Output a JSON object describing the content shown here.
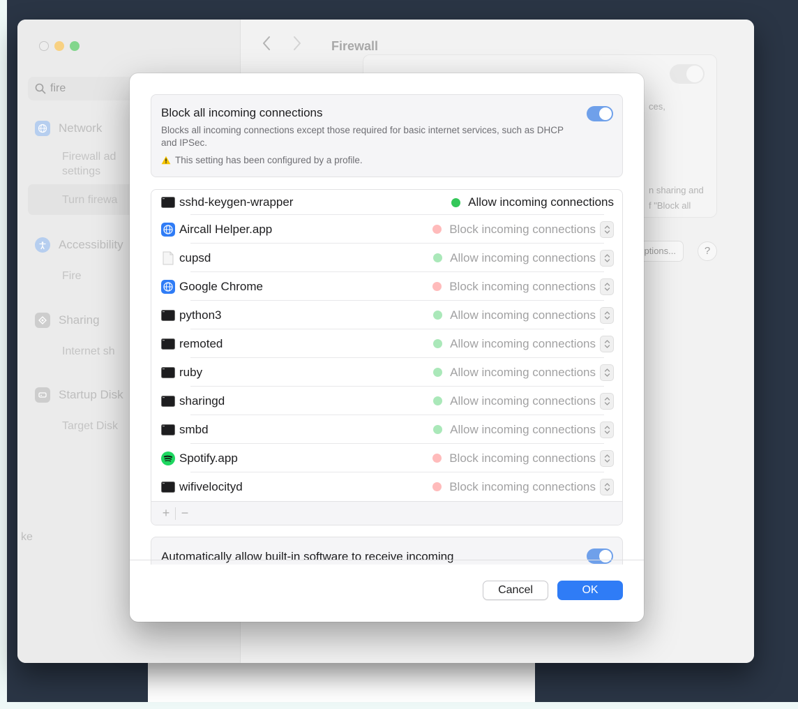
{
  "window": {
    "title": "Firewall",
    "search": {
      "value": "fire"
    }
  },
  "sidebar": {
    "sections": [
      {
        "label": "Network",
        "icon": "globe-icon",
        "color": "#4f8fe0"
      },
      {
        "label": "Accessibility",
        "icon": "accessibility-icon",
        "color": "#4f8fe0"
      },
      {
        "label": "Sharing",
        "icon": "sharing-icon",
        "color": "#8e8e93"
      },
      {
        "label": "Startup Disk",
        "icon": "disk-icon",
        "color": "#8e8e93"
      }
    ],
    "items": {
      "firewall_advanced_1": "Firewall ad",
      "firewall_advanced_2": "settings",
      "turn_firewall": "Turn firewa",
      "fire": "Fire",
      "internet_sharing": "Internet sh",
      "target_disk": "Target Disk",
      "stray": "ke"
    }
  },
  "background": {
    "text1": "ces,",
    "text2": "n sharing and",
    "text3": "f \"Block all",
    "options_button": "ptions...",
    "help_button": "?"
  },
  "dialog": {
    "block_all": {
      "title": "Block all incoming connections",
      "description": "Blocks all incoming connections except those required for basic internet services, such as DHCP and IPSec.",
      "warning": "This setting has been configured by a profile.",
      "enabled": true
    },
    "apps": [
      {
        "name": "sshd-keygen-wrapper",
        "icon": "terminal-icon",
        "status": "Allow incoming connections",
        "state": "allow",
        "dimmed": false,
        "has_stepper": false
      },
      {
        "name": "Aircall Helper.app",
        "icon": "globe-app-icon",
        "status": "Block incoming connections",
        "state": "block",
        "dimmed": true,
        "has_stepper": true
      },
      {
        "name": "cupsd",
        "icon": "document-icon",
        "status": "Allow incoming connections",
        "state": "allow",
        "dimmed": true,
        "has_stepper": true
      },
      {
        "name": "Google Chrome",
        "icon": "globe-app-icon",
        "status": "Block incoming connections",
        "state": "block",
        "dimmed": true,
        "has_stepper": true
      },
      {
        "name": "python3",
        "icon": "terminal-icon",
        "status": "Allow incoming connections",
        "state": "allow",
        "dimmed": true,
        "has_stepper": true
      },
      {
        "name": "remoted",
        "icon": "terminal-icon",
        "status": "Allow incoming connections",
        "state": "allow",
        "dimmed": true,
        "has_stepper": true
      },
      {
        "name": "ruby",
        "icon": "terminal-icon",
        "status": "Allow incoming connections",
        "state": "allow",
        "dimmed": true,
        "has_stepper": true
      },
      {
        "name": "sharingd",
        "icon": "terminal-icon",
        "status": "Allow incoming connections",
        "state": "allow",
        "dimmed": true,
        "has_stepper": true
      },
      {
        "name": "smbd",
        "icon": "terminal-icon",
        "status": "Allow incoming connections",
        "state": "allow",
        "dimmed": true,
        "has_stepper": true
      },
      {
        "name": "Spotify.app",
        "icon": "spotify-icon",
        "status": "Block incoming connections",
        "state": "block",
        "dimmed": true,
        "has_stepper": true
      },
      {
        "name": "wifivelocityd",
        "icon": "terminal-icon",
        "status": "Block incoming connections",
        "state": "block",
        "dimmed": true,
        "has_stepper": true
      }
    ],
    "list_footer": {
      "add": "+",
      "remove": "−"
    },
    "auto_allow": {
      "title": "Automatically allow built-in software to receive incoming",
      "enabled": true
    },
    "buttons": {
      "cancel": "Cancel",
      "ok": "OK"
    }
  },
  "colors": {
    "allow": "#34c759",
    "block": "#ff5c5c",
    "accent": "#2f7cf6"
  }
}
